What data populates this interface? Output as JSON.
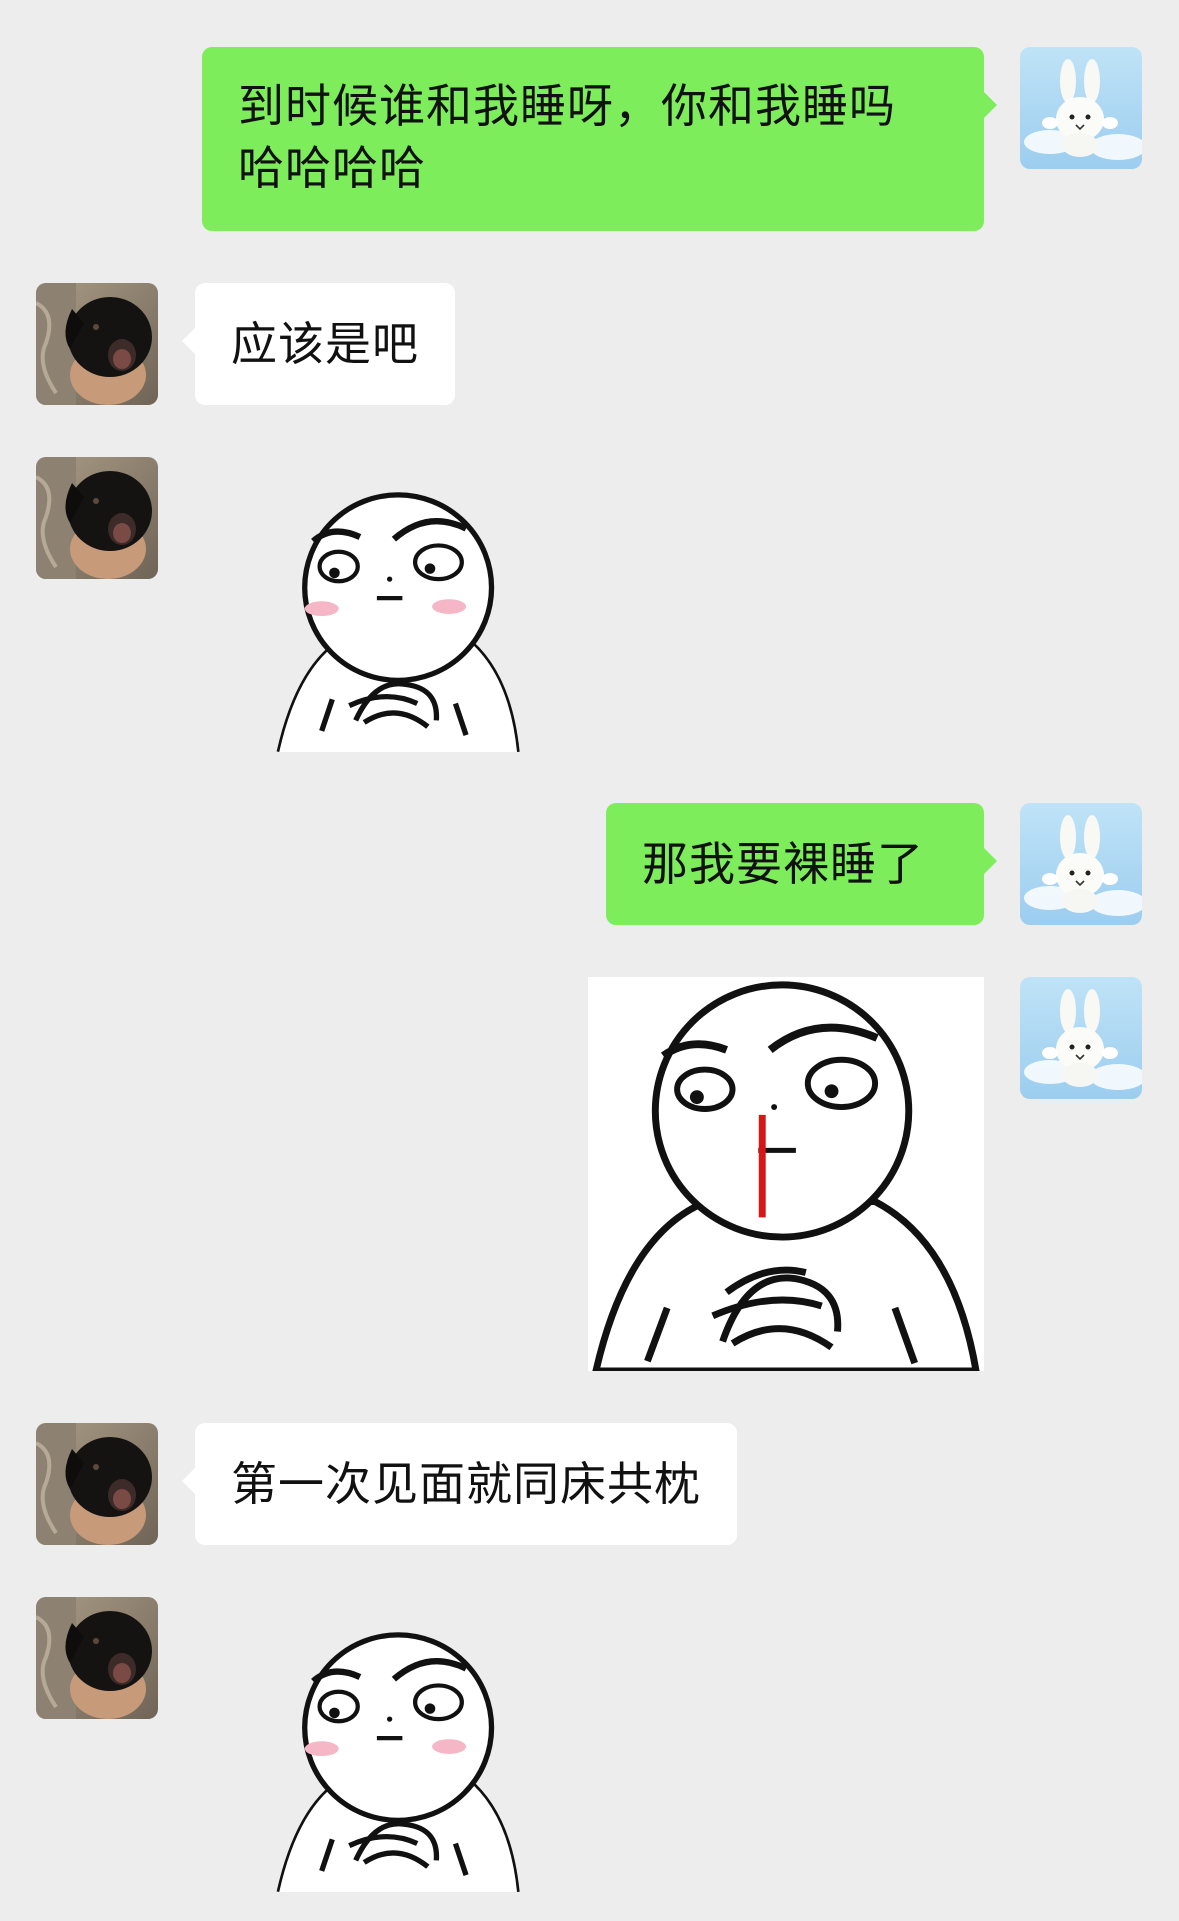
{
  "messages": [
    {
      "side": "right",
      "type": "text",
      "text": "到时候谁和我睡呀，你和我睡吗哈哈哈哈",
      "lines": [
        "到时候谁和我睡呀，你和我睡吗",
        "哈哈哈哈"
      ]
    },
    {
      "side": "left",
      "type": "text",
      "text": "应该是吧"
    },
    {
      "side": "left",
      "type": "sticker",
      "name": "blushing-face-hands-clasped"
    },
    {
      "side": "right",
      "type": "text",
      "text": "那我要裸睡了"
    },
    {
      "side": "right",
      "type": "sticker",
      "name": "nosebleed-face-hands-clasped"
    },
    {
      "side": "left",
      "type": "text",
      "text": "第一次见面就同床共枕"
    },
    {
      "side": "left",
      "type": "sticker",
      "name": "blushing-face-hands-clasped"
    }
  ],
  "avatars": {
    "me": "white-rabbit-sky-avatar",
    "friend": "black-dog-avatar"
  },
  "colors": {
    "background": "#ededed",
    "my_bubble": "#7ded5b",
    "friend_bubble": "#ffffff"
  }
}
